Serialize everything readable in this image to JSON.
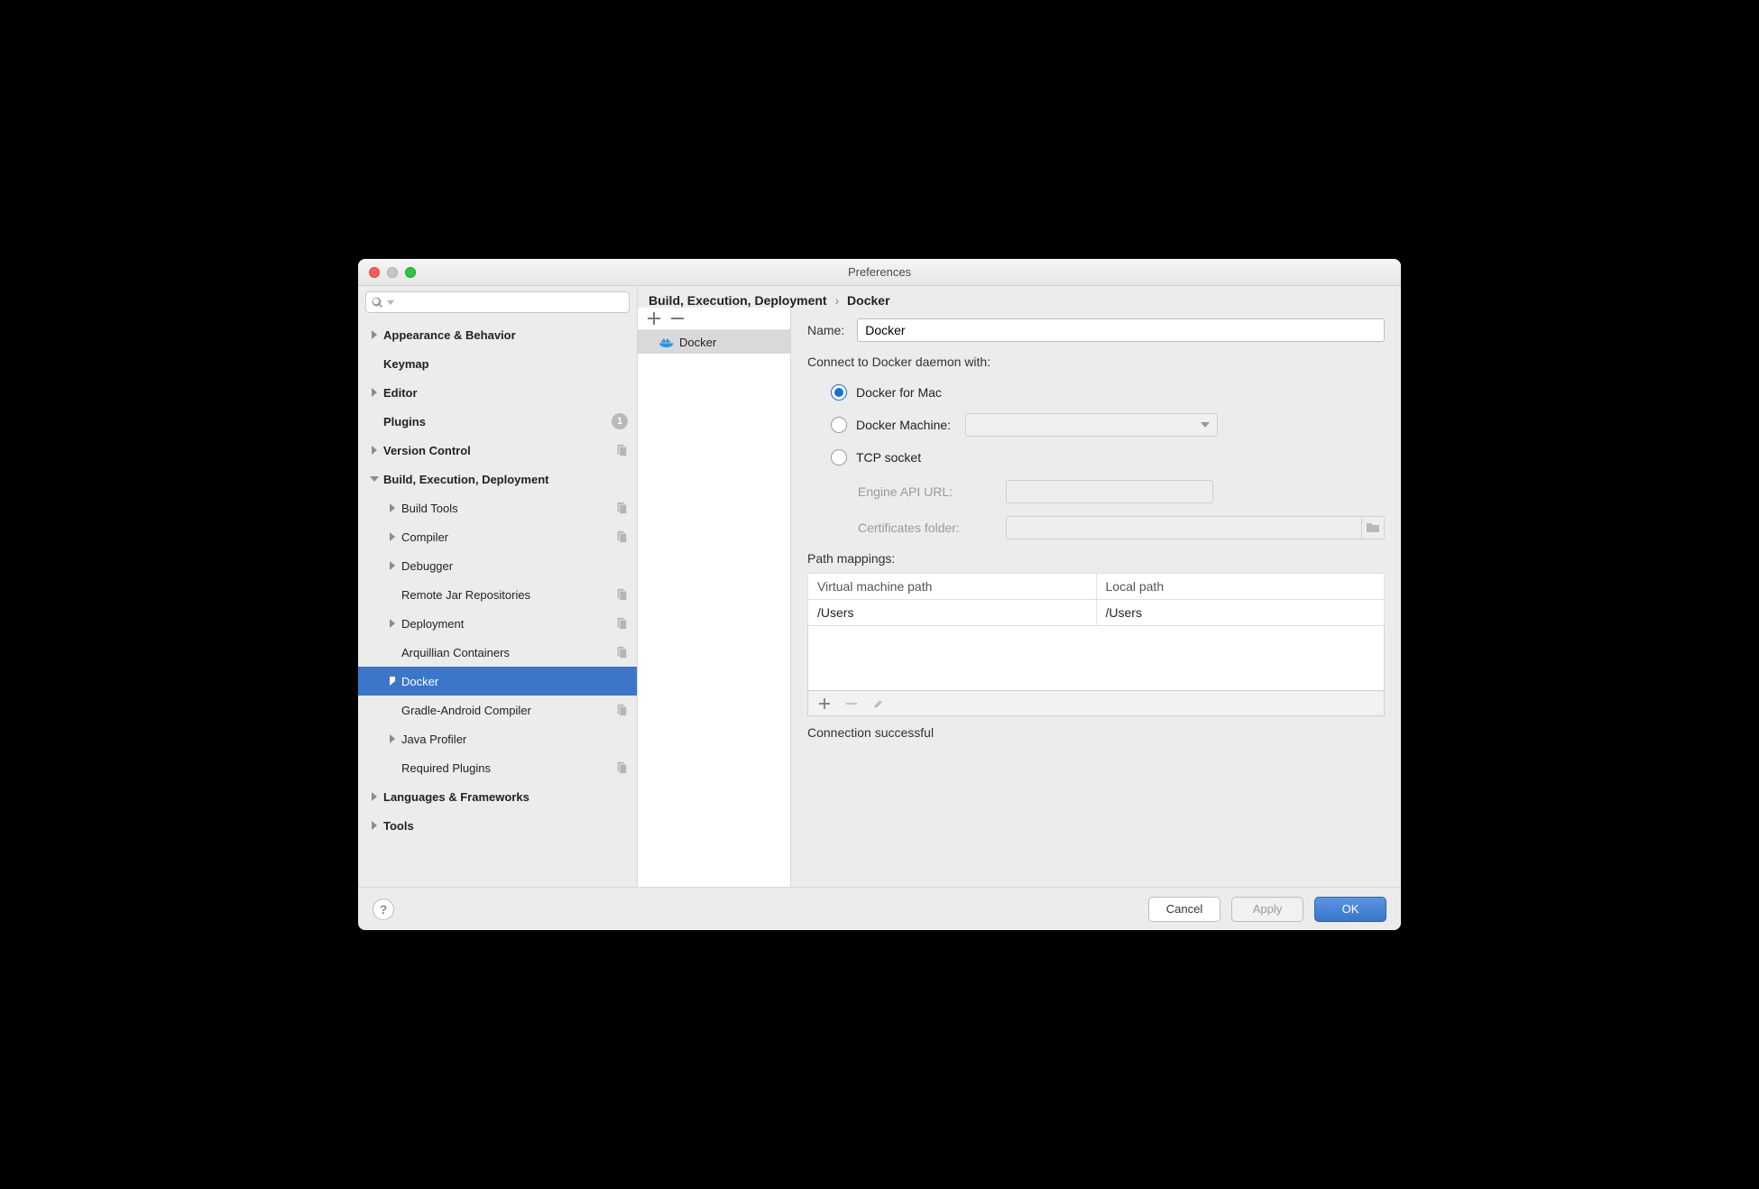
{
  "window": {
    "title": "Preferences"
  },
  "search": {
    "placeholder": ""
  },
  "tree": [
    {
      "label": "Appearance & Behavior",
      "depth": 0,
      "bold": true,
      "arrow": "right"
    },
    {
      "label": "Keymap",
      "depth": 0,
      "bold": true,
      "arrow": "none"
    },
    {
      "label": "Editor",
      "depth": 0,
      "bold": true,
      "arrow": "right"
    },
    {
      "label": "Plugins",
      "depth": 0,
      "bold": true,
      "arrow": "none",
      "badge": "1"
    },
    {
      "label": "Version Control",
      "depth": 0,
      "bold": true,
      "arrow": "right",
      "copy": true
    },
    {
      "label": "Build, Execution, Deployment",
      "depth": 0,
      "bold": true,
      "arrow": "down"
    },
    {
      "label": "Build Tools",
      "depth": 1,
      "arrow": "right",
      "copy": true
    },
    {
      "label": "Compiler",
      "depth": 1,
      "arrow": "right",
      "copy": true
    },
    {
      "label": "Debugger",
      "depth": 1,
      "arrow": "right"
    },
    {
      "label": "Remote Jar Repositories",
      "depth": 1,
      "arrow": "none",
      "copy": true
    },
    {
      "label": "Deployment",
      "depth": 1,
      "arrow": "right",
      "copy": true
    },
    {
      "label": "Arquillian Containers",
      "depth": 1,
      "arrow": "none",
      "copy": true
    },
    {
      "label": "Docker",
      "depth": 1,
      "arrow": "right",
      "selected": true
    },
    {
      "label": "Gradle-Android Compiler",
      "depth": 1,
      "arrow": "none",
      "copy": true
    },
    {
      "label": "Java Profiler",
      "depth": 1,
      "arrow": "right"
    },
    {
      "label": "Required Plugins",
      "depth": 1,
      "arrow": "none",
      "copy": true
    },
    {
      "label": "Languages & Frameworks",
      "depth": 0,
      "bold": true,
      "arrow": "right"
    },
    {
      "label": "Tools",
      "depth": 0,
      "bold": true,
      "arrow": "right"
    }
  ],
  "breadcrumb": {
    "a": "Build, Execution, Deployment",
    "sep": "›",
    "b": "Docker"
  },
  "mid": {
    "items": [
      "Docker"
    ],
    "selectedIndex": 0
  },
  "form": {
    "name_label": "Name:",
    "name_value": "Docker",
    "connect_label": "Connect to Docker daemon with:",
    "radios": {
      "dockerForMac": "Docker for Mac",
      "dockerMachine": "Docker Machine:",
      "tcpSocket": "TCP socket",
      "selected": "dockerForMac"
    },
    "engine_label": "Engine API URL:",
    "certs_label": "Certificates folder:",
    "path_mappings_label": "Path mappings:",
    "table": {
      "cols": [
        "Virtual machine path",
        "Local path"
      ],
      "rows": [
        [
          "/Users",
          "/Users"
        ]
      ]
    },
    "status": "Connection successful"
  },
  "footer": {
    "cancel": "Cancel",
    "apply": "Apply",
    "ok": "OK"
  }
}
